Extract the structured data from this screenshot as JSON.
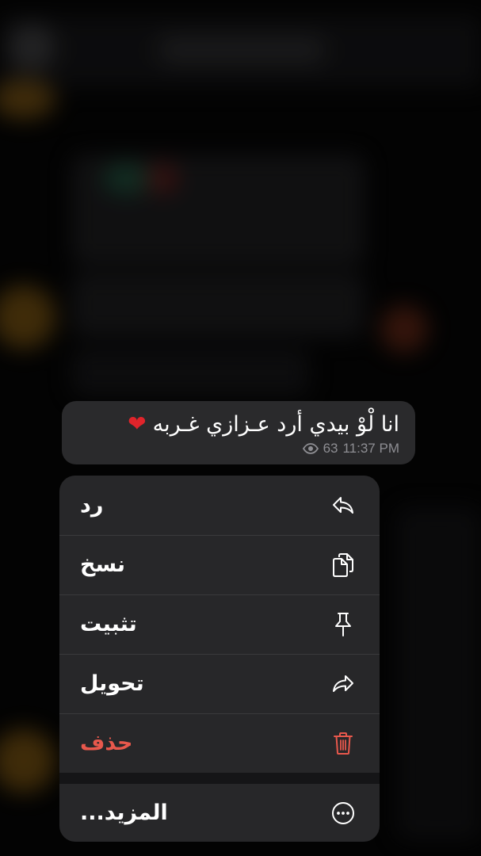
{
  "message": {
    "text": "انا لْوْ بيدي أرد عـزازي غـربه",
    "emoji": "❤",
    "views": "63",
    "time": "11:37 PM",
    "colors": {
      "bubble": "#2a2a2c",
      "heart": "#e0242b",
      "meta": "#8e8e93"
    }
  },
  "context_menu": {
    "items": [
      {
        "label": "رد",
        "icon": "reply-icon"
      },
      {
        "label": "نسخ",
        "icon": "copy-icon"
      },
      {
        "label": "تثبيت",
        "icon": "pin-icon"
      },
      {
        "label": "تحويل",
        "icon": "forward-icon"
      },
      {
        "label": "حذف",
        "icon": "trash-icon",
        "destructive": true
      },
      {
        "label": "المزيد...",
        "icon": "more-icon"
      }
    ],
    "colors": {
      "background": "#272729",
      "text": "#ffffff",
      "destructive": "#e8584c"
    }
  }
}
